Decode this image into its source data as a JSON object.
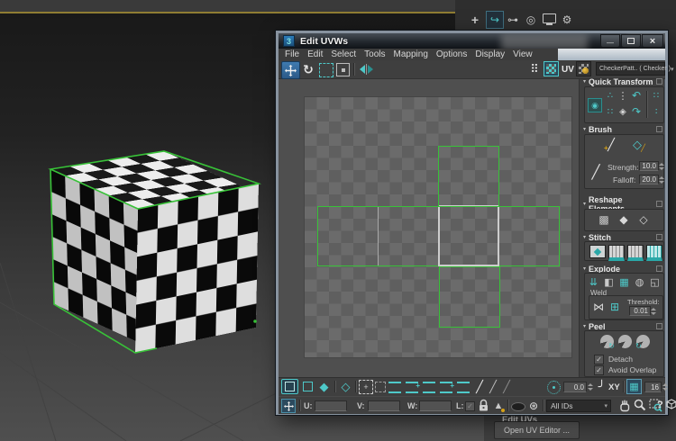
{
  "window": {
    "title": "Edit UVWs",
    "app_icon": "3",
    "minimize_glyph": "—",
    "close_glyph": "×"
  },
  "menu": {
    "items": [
      "File",
      "Edit",
      "Select",
      "Tools",
      "Mapping",
      "Options",
      "Display",
      "View"
    ]
  },
  "toolbar": {
    "uv_label": "UV",
    "map_dropdown": "CheckerPatt.. ( Checker )"
  },
  "sidebar": {
    "quick_transform": {
      "title": "Quick Transform"
    },
    "brush": {
      "title": "Brush",
      "strength_label": "Strength:",
      "strength_value": "10.0",
      "falloff_label": "Falloff:",
      "falloff_value": "20.0"
    },
    "reshape": {
      "title": "Reshape Elements"
    },
    "stitch": {
      "title": "Stitch"
    },
    "explode": {
      "title": "Explode",
      "weld_label": "Weld",
      "threshold_label": "Threshold:",
      "threshold_value": "0.01"
    },
    "peel": {
      "title": "Peel",
      "detach_label": "Detach",
      "avoid_overlap_label": "Avoid Overlap"
    }
  },
  "bottom": {
    "u_label": "U:",
    "v_label": "V:",
    "w_label": "W:",
    "l_label": "L:",
    "soft_value": "0.0",
    "xy_label": "XY",
    "grid_value": "16",
    "all_ids": "All IDs",
    "help": "?"
  },
  "command_panel": {
    "edit_uvs_label": "Edit UVs",
    "open_uv_editor_label": "Open UV Editor ..."
  },
  "colors": {
    "accent_teal": "#4ec9c9",
    "seam_green": "#38c238",
    "selection_blue": "#2c4a5e",
    "gold": "#d4a017"
  },
  "icons": {
    "rotate": "↻",
    "checker_dots": "⠿",
    "qt_a": "∴",
    "qt_b": "⋮",
    "qt_c": "↶",
    "qt_d": "∷",
    "qt_e": "◈",
    "qt_f": "↷",
    "qt_g": "∶",
    "brush_stroke": "╱",
    "relax_cube": "◇",
    "falloff_line": "╱",
    "reshape_a": "▩",
    "reshape_b": "◆",
    "reshape_c": "◇",
    "explode_a": "⇊",
    "explode_b": "◧",
    "explode_c": "▦",
    "explode_d": "◍",
    "explode_e": "◱",
    "weld_target": "⋈",
    "weld_selected": "⊞",
    "peel_arrow": "↻",
    "face_filled": "◆",
    "face_outline": "◇",
    "snowflake": "⊛",
    "curve": "╯",
    "grid": "▦",
    "check": "✓",
    "dropdown_arrow": "▾",
    "mirror_tri": "▲",
    "tab_create": "+",
    "tab_modify": "↪",
    "tab_hierarchy": "⊶",
    "tab_motion": "◎",
    "tab_utilities": "⚙"
  }
}
